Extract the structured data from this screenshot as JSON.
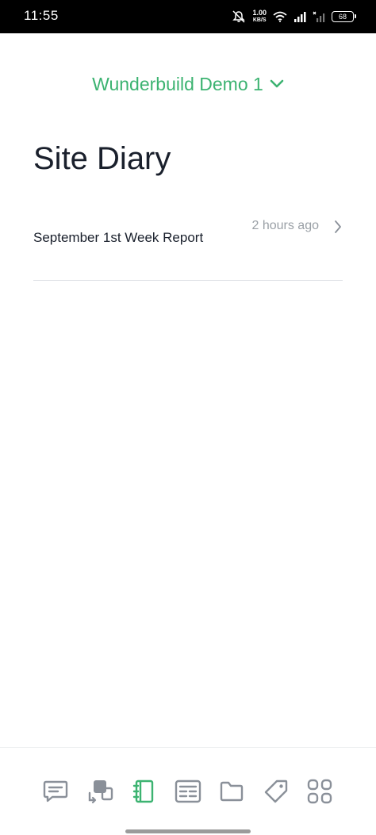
{
  "status_bar": {
    "time": "11:55",
    "net_speed_value": "1.00",
    "net_speed_unit": "KB/S",
    "battery": "68"
  },
  "header": {
    "project_name": "Wunderbuild Demo 1"
  },
  "page": {
    "title": "Site Diary"
  },
  "diary_entries": [
    {
      "title": "September 1st Week Report",
      "time": "2 hours ago"
    }
  ],
  "bottom_nav": {
    "items": [
      {
        "name": "messages-icon",
        "active": false
      },
      {
        "name": "transfer-icon",
        "active": false
      },
      {
        "name": "site-diary-icon",
        "active": true
      },
      {
        "name": "forms-icon",
        "active": false
      },
      {
        "name": "folder-icon",
        "active": false
      },
      {
        "name": "tag-icon",
        "active": false
      },
      {
        "name": "more-apps-icon",
        "active": false
      }
    ]
  },
  "colors": {
    "accent_green": "#3cb371",
    "nav_inactive": "#8a9099",
    "text_dark": "#1a202c",
    "text_muted": "#9aa0a6"
  }
}
